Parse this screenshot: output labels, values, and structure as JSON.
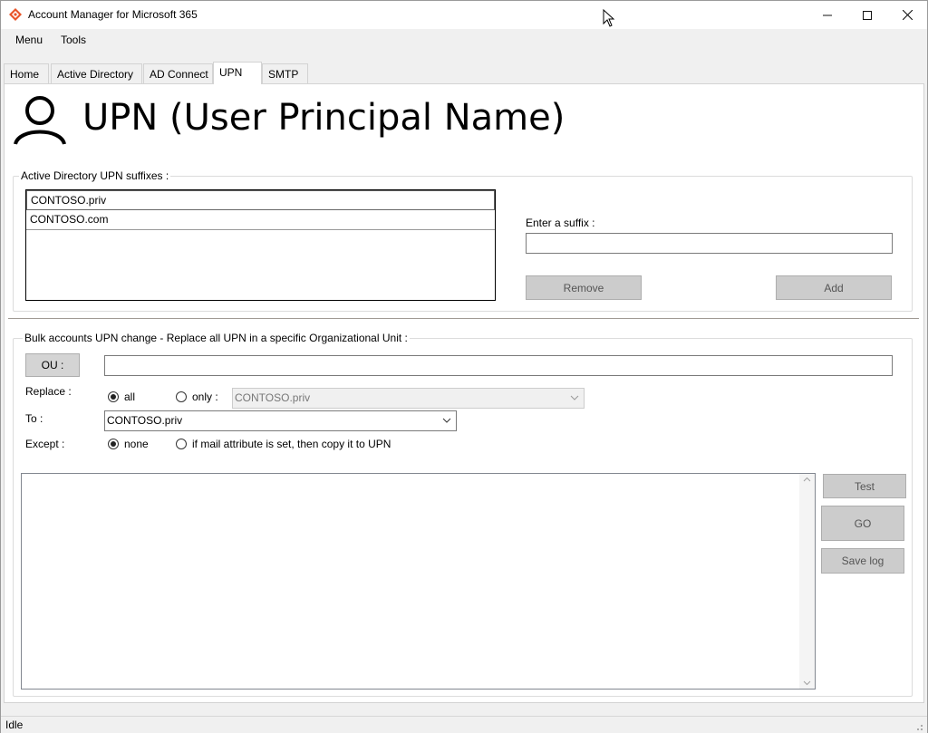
{
  "window": {
    "title": "Account Manager for Microsoft 365",
    "accent": "#e8552a"
  },
  "menubar": {
    "items": [
      "Menu",
      "Tools"
    ]
  },
  "tabs": [
    {
      "label": "Home",
      "active": false
    },
    {
      "label": "Active Directory",
      "active": false
    },
    {
      "label": "AD Connect",
      "active": false
    },
    {
      "label": "UPN",
      "active": true
    },
    {
      "label": "SMTP",
      "active": false
    }
  ],
  "header": {
    "title": "UPN (User Principal Name)",
    "icon": "user-icon"
  },
  "suffixes": {
    "legend": "Active Directory UPN suffixes :",
    "items": [
      "CONTOSO.priv",
      "CONTOSO.com"
    ],
    "enter_label": "Enter a suffix :",
    "enter_value": "",
    "remove_label": "Remove",
    "add_label": "Add"
  },
  "bulk": {
    "legend": "Bulk accounts UPN change - Replace all UPN in a specific Organizational Unit :",
    "ou_button": "OU :",
    "ou_value": "",
    "replace_label": "Replace :",
    "replace_all": "all",
    "replace_only": "only :",
    "replace_selected": "all",
    "only_combo": "CONTOSO.priv",
    "to_label": "To :",
    "to_combo": "CONTOSO.priv",
    "except_label": "Except :",
    "except_none": "none",
    "except_mail": "if mail attribute is set, then copy it to UPN",
    "except_selected": "none"
  },
  "actions": {
    "test": "Test",
    "go": "GO",
    "save_log": "Save log"
  },
  "log": {
    "content": ""
  },
  "status": {
    "text": "Idle"
  }
}
